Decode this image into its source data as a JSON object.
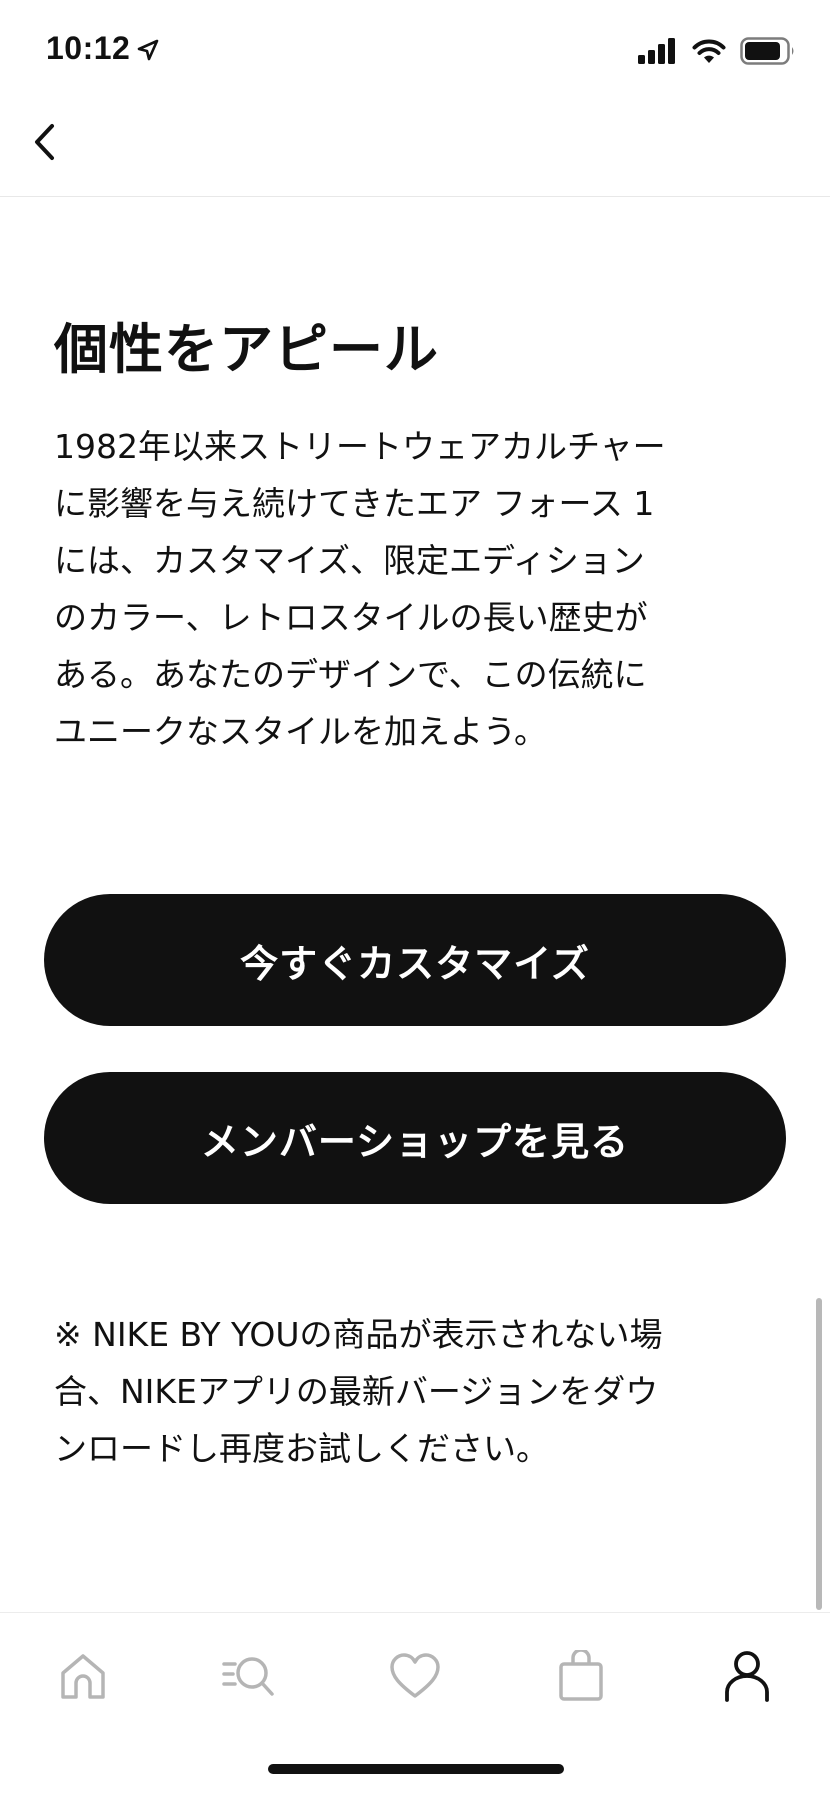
{
  "status_bar": {
    "time": "10:12",
    "icons": [
      "location-arrow-icon",
      "signal-bars-icon",
      "wifi-icon",
      "battery-icon"
    ]
  },
  "header": {
    "back_icon": "chevron-left-icon"
  },
  "content": {
    "title": "個性をアピール",
    "description_lines": [
      "1982年以来ストリートウェアカルチャー",
      "に影響を与え続けてきたエア フォース 1",
      "には、カスタマイズ、限定エディション",
      "のカラー、レトロスタイルの長い歴史が",
      "ある。あなたのデザインで、この伝統に",
      "ユニークなスタイルを加えよう。"
    ],
    "buttons": {
      "customize_label": "今すぐカスタマイズ",
      "membershop_label": "メンバーショップを見る"
    },
    "note_lines": [
      "※ NIKE BY YOUの商品が表示されない場",
      "合、NIKEアプリの最新バージョンをダウ",
      "ンロードし再度お試しください。"
    ]
  },
  "tab_bar": {
    "tabs": [
      {
        "icon": "home-icon",
        "active": false
      },
      {
        "icon": "search-list-icon",
        "active": false
      },
      {
        "icon": "heart-icon",
        "active": false
      },
      {
        "icon": "bag-icon",
        "active": false
      },
      {
        "icon": "profile-icon",
        "active": true
      }
    ]
  },
  "colors": {
    "text": "#111111",
    "button_bg": "#111111",
    "button_text": "#ffffff",
    "inactive_icon": "#b5b5b5",
    "active_icon": "#111111"
  }
}
